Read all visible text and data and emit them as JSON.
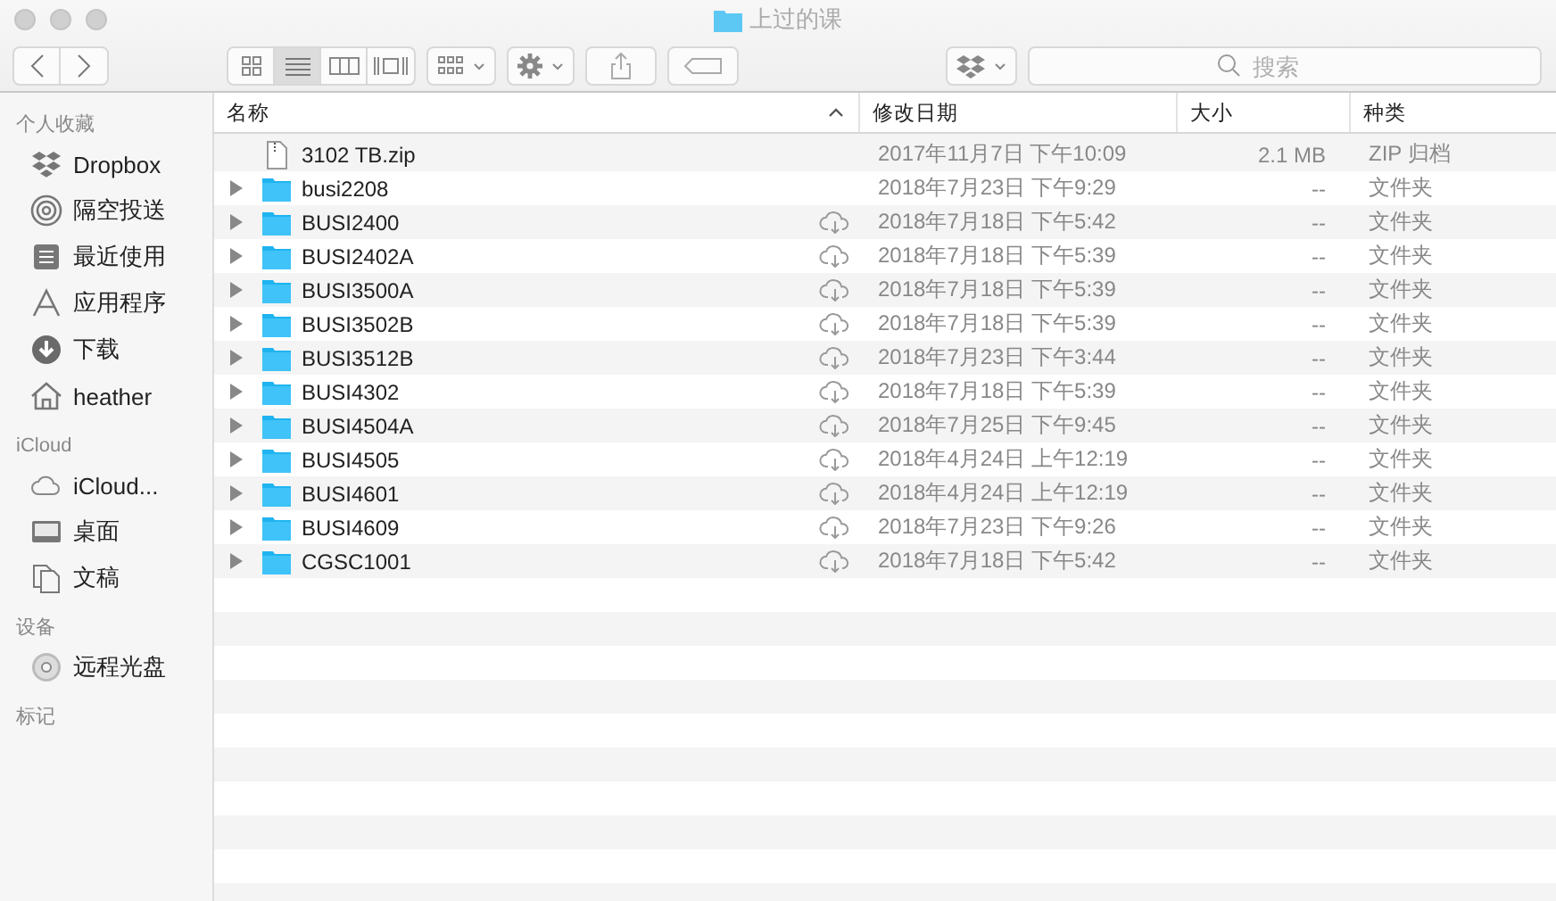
{
  "window": {
    "title": "上过的课"
  },
  "toolbar": {
    "view_modes": [
      {
        "kind": "icons",
        "selected": false
      },
      {
        "kind": "list",
        "selected": true
      },
      {
        "kind": "columns",
        "selected": false
      },
      {
        "kind": "gallery",
        "selected": false
      }
    ],
    "search": {
      "placeholder": "搜索"
    }
  },
  "sidebar": {
    "sections": [
      {
        "title": "个人收藏",
        "items": [
          {
            "label": "Dropbox",
            "kind": "dropbox"
          },
          {
            "label": "隔空投送",
            "kind": "airdrop"
          },
          {
            "label": "最近使用",
            "kind": "recents"
          },
          {
            "label": "应用程序",
            "kind": "apps"
          },
          {
            "label": "下载",
            "kind": "downloads"
          },
          {
            "label": "heather",
            "kind": "home"
          }
        ]
      },
      {
        "title": "iCloud",
        "items": [
          {
            "label": "iCloud...",
            "kind": "cloud"
          },
          {
            "label": "桌面",
            "kind": "desktop"
          },
          {
            "label": "文稿",
            "kind": "documents"
          }
        ]
      },
      {
        "title": "设备",
        "items": [
          {
            "label": "远程光盘",
            "kind": "disc"
          }
        ]
      },
      {
        "title": "标记"
      }
    ]
  },
  "table": {
    "columns": [
      "名称",
      "修改日期",
      "大小",
      "种类"
    ],
    "rows": [
      {
        "kind": "file",
        "name": "3102 TB.zip",
        "cloud": false,
        "date": "2017年11月7日 下午10:09",
        "size": "2.1 MB",
        "type": "ZIP 归档"
      },
      {
        "kind": "folder",
        "name": "busi2208",
        "cloud": false,
        "date": "2018年7月23日 下午9:29",
        "size": "--",
        "type": "文件夹"
      },
      {
        "kind": "folder",
        "name": "BUSI2400",
        "cloud": true,
        "date": "2018年7月18日 下午5:42",
        "size": "--",
        "type": "文件夹"
      },
      {
        "kind": "folder",
        "name": "BUSI2402A",
        "cloud": true,
        "date": "2018年7月18日 下午5:39",
        "size": "--",
        "type": "文件夹"
      },
      {
        "kind": "folder",
        "name": "BUSI3500A",
        "cloud": true,
        "date": "2018年7月18日 下午5:39",
        "size": "--",
        "type": "文件夹"
      },
      {
        "kind": "folder",
        "name": "BUSI3502B",
        "cloud": true,
        "date": "2018年7月18日 下午5:39",
        "size": "--",
        "type": "文件夹"
      },
      {
        "kind": "folder",
        "name": "BUSI3512B",
        "cloud": true,
        "date": "2018年7月23日 下午3:44",
        "size": "--",
        "type": "文件夹"
      },
      {
        "kind": "folder",
        "name": "BUSI4302",
        "cloud": true,
        "date": "2018年7月18日 下午5:39",
        "size": "--",
        "type": "文件夹"
      },
      {
        "kind": "folder",
        "name": "BUSI4504A",
        "cloud": true,
        "date": "2018年7月25日 下午9:45",
        "size": "--",
        "type": "文件夹"
      },
      {
        "kind": "folder",
        "name": "BUSI4505",
        "cloud": true,
        "date": "2018年4月24日 上午12:19",
        "size": "--",
        "type": "文件夹"
      },
      {
        "kind": "folder",
        "name": "BUSI4601",
        "cloud": true,
        "date": "2018年4月24日 上午12:19",
        "size": "--",
        "type": "文件夹"
      },
      {
        "kind": "folder",
        "name": "BUSI4609",
        "cloud": true,
        "date": "2018年7月23日 下午9:26",
        "size": "--",
        "type": "文件夹"
      },
      {
        "kind": "folder",
        "name": "CGSC1001",
        "cloud": true,
        "date": "2018年7月18日 下午5:42",
        "size": "--",
        "type": "文件夹"
      }
    ]
  }
}
